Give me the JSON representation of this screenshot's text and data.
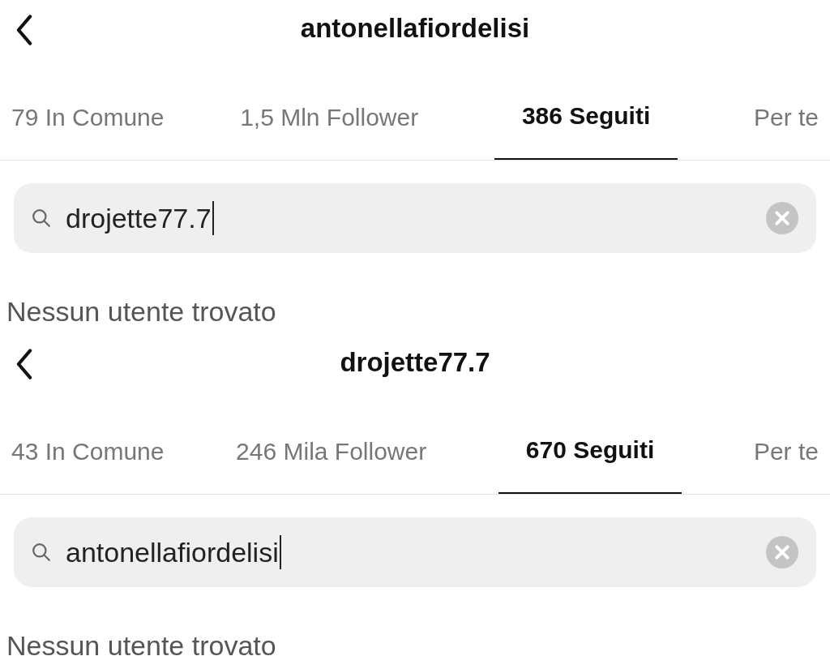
{
  "panels": [
    {
      "header": {
        "title": "antonellafiordelisi"
      },
      "tabs": [
        {
          "label": "79 In Comune",
          "selected": false
        },
        {
          "label": "1,5 Mln Follower",
          "selected": false
        },
        {
          "label": "386 Seguiti",
          "selected": true
        },
        {
          "label": "Per te",
          "selected": false
        }
      ],
      "search": {
        "value": "drojette77.7"
      },
      "message": "Nessun utente trovato"
    },
    {
      "header": {
        "title": "drojette77.7"
      },
      "tabs": [
        {
          "label": "43 In Comune",
          "selected": false
        },
        {
          "label": "246 Mila Follower",
          "selected": false
        },
        {
          "label": "670 Seguiti",
          "selected": true
        },
        {
          "label": "Per te",
          "selected": false
        }
      ],
      "search": {
        "value": "antonellafiordelisi"
      },
      "message": "Nessun utente trovato"
    }
  ]
}
